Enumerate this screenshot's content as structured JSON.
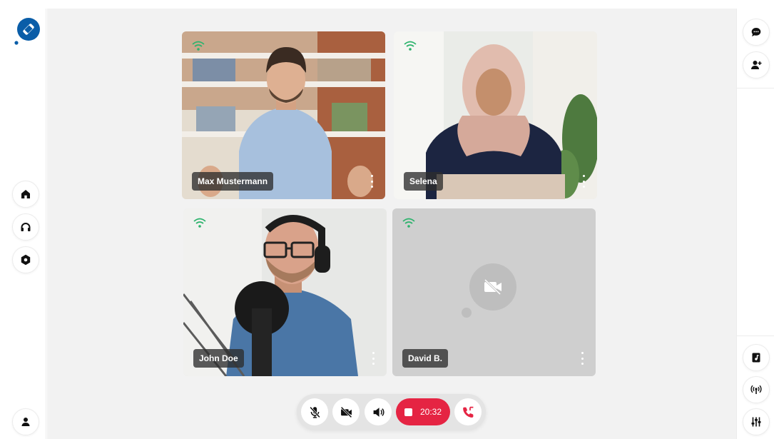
{
  "brand": {
    "accent": "#0a5da8",
    "danger": "#e52443",
    "signal": "#2db36d"
  },
  "left_nav": {
    "items": [
      "home-icon",
      "headphones-icon",
      "settings-icon"
    ],
    "profile_icon": "user-icon"
  },
  "right_toolbar": {
    "top": [
      "chat-icon",
      "add-user-icon"
    ],
    "bottom": [
      "music-file-icon",
      "broadcast-icon",
      "sliders-icon"
    ]
  },
  "participants": [
    {
      "name": "Max Mustermann",
      "video": true,
      "signal": "good"
    },
    {
      "name": "Selena",
      "video": true,
      "signal": "good"
    },
    {
      "name": "John Doe",
      "video": true,
      "signal": "good"
    },
    {
      "name": "David B.",
      "video": false,
      "signal": "good"
    }
  ],
  "controls": {
    "buttons": [
      "mic-off-icon",
      "camera-off-icon",
      "speaker-icon",
      "hang-up-icon"
    ],
    "recording_timer": "20:32"
  }
}
